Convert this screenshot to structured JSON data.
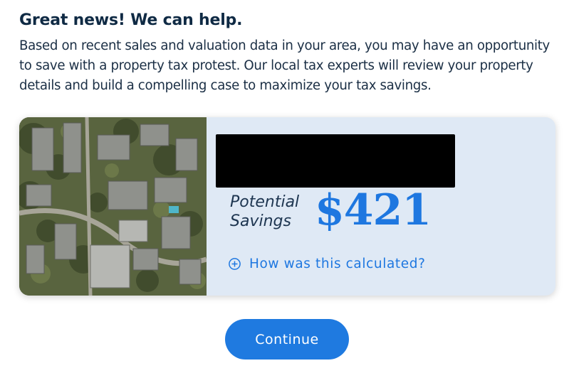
{
  "headline": "Great news! We can help.",
  "intro": "Based on recent sales and valuation data in your area, you may have an opportunity to save with a property tax protest. Our local tax experts will review your property details and build a compelling case to maximize your tax savings.",
  "card": {
    "savings_label_line1": "Potential",
    "savings_label_line2": "Savings",
    "savings_amount": "$421",
    "how_link": "How was this calculated?"
  },
  "continue_label": "Continue",
  "colors": {
    "accent": "#1e77e0",
    "heading": "#0f2a44",
    "card_background": "#dfe9f5"
  }
}
